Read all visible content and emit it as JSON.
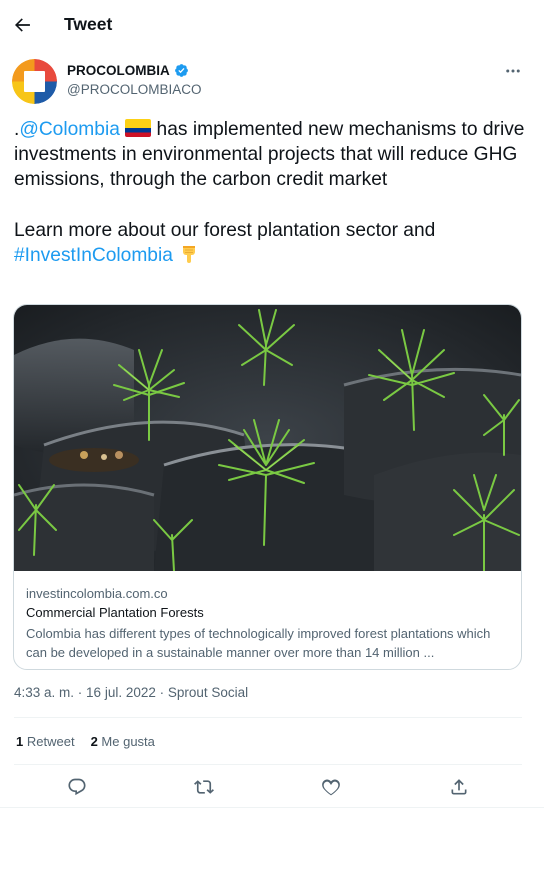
{
  "header": {
    "title": "Tweet",
    "back_icon": "arrow-left-icon"
  },
  "author": {
    "name": "PROCOLOMBIA",
    "handle": "@PROCOLOMBIACO",
    "verified": true,
    "avatar_icon": "procolombia-logo",
    "verified_icon": "verified-badge-icon"
  },
  "tweet": {
    "period": ".",
    "mention": "@Colombia",
    "flag_icon": "colombia-flag-icon",
    "text_1": " has implemented new mechanisms to drive investments in environmental projects that will reduce GHG emissions, through the carbon credit market",
    "text_2": "Learn more about our forest plantation sector and ",
    "hashtag": "#InvestInColombia",
    "emoji_icon": "backhand-index-pointing-down-icon"
  },
  "card": {
    "image_icon": "pine-seedlings-photo",
    "domain": "investincolombia.com.co",
    "title": "Commercial Plantation Forests",
    "description": "Colombia has different types of technologically improved forest plantations which can be developed in a sustainable manner over more than 14 million ..."
  },
  "meta": {
    "time": "4:33 a. m.",
    "separator": " · ",
    "date": "16 jul. 2022",
    "source": "Sprout Social"
  },
  "stats": {
    "retweet_count": "1",
    "retweet_label": "Retweet",
    "like_count": "2",
    "like_label": "Me gusta"
  },
  "actions": [
    "reply-icon",
    "retweet-icon",
    "like-icon",
    "share-icon"
  ],
  "colors": {
    "link": "#1d9bf0",
    "text": "#0f1419",
    "secondary": "#536471",
    "border": "#cfd9de"
  }
}
